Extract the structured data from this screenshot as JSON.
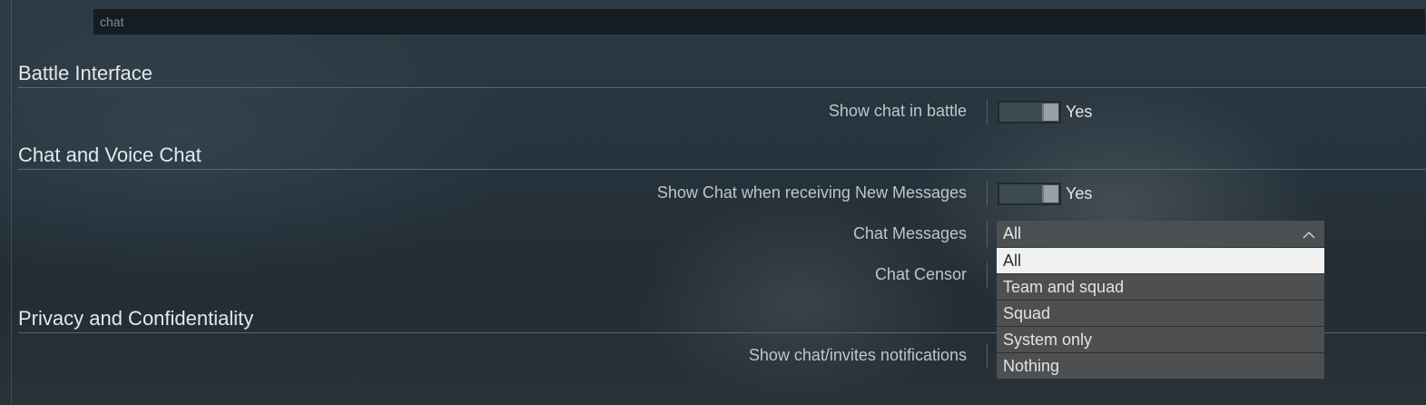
{
  "search": {
    "value": "chat"
  },
  "sections": {
    "battle_interface": {
      "title": "Battle Interface"
    },
    "chat_voice": {
      "title": "Chat and Voice Chat"
    },
    "privacy": {
      "title": "Privacy and Confidentiality"
    }
  },
  "rows": {
    "show_chat_in_battle": {
      "label": "Show chat in battle",
      "value": "Yes"
    },
    "show_chat_new_messages": {
      "label": "Show Chat when receiving New Messages",
      "value": "Yes"
    },
    "chat_messages": {
      "label": "Chat Messages",
      "value": "All"
    },
    "chat_censor": {
      "label": "Chat Censor"
    },
    "show_chat_invites": {
      "label": "Show chat/invites notifications"
    }
  },
  "dropdown": {
    "options": [
      "All",
      "Team and squad",
      "Squad",
      "System only",
      "Nothing"
    ],
    "selected": "All"
  },
  "colors": {
    "dropdown_bg": "#4d4f50",
    "dropdown_active_bg": "#f1f1f1",
    "section_text": "#e4e8ea"
  },
  "icons": {
    "dropdown_chevron": "chevron-up-icon"
  }
}
